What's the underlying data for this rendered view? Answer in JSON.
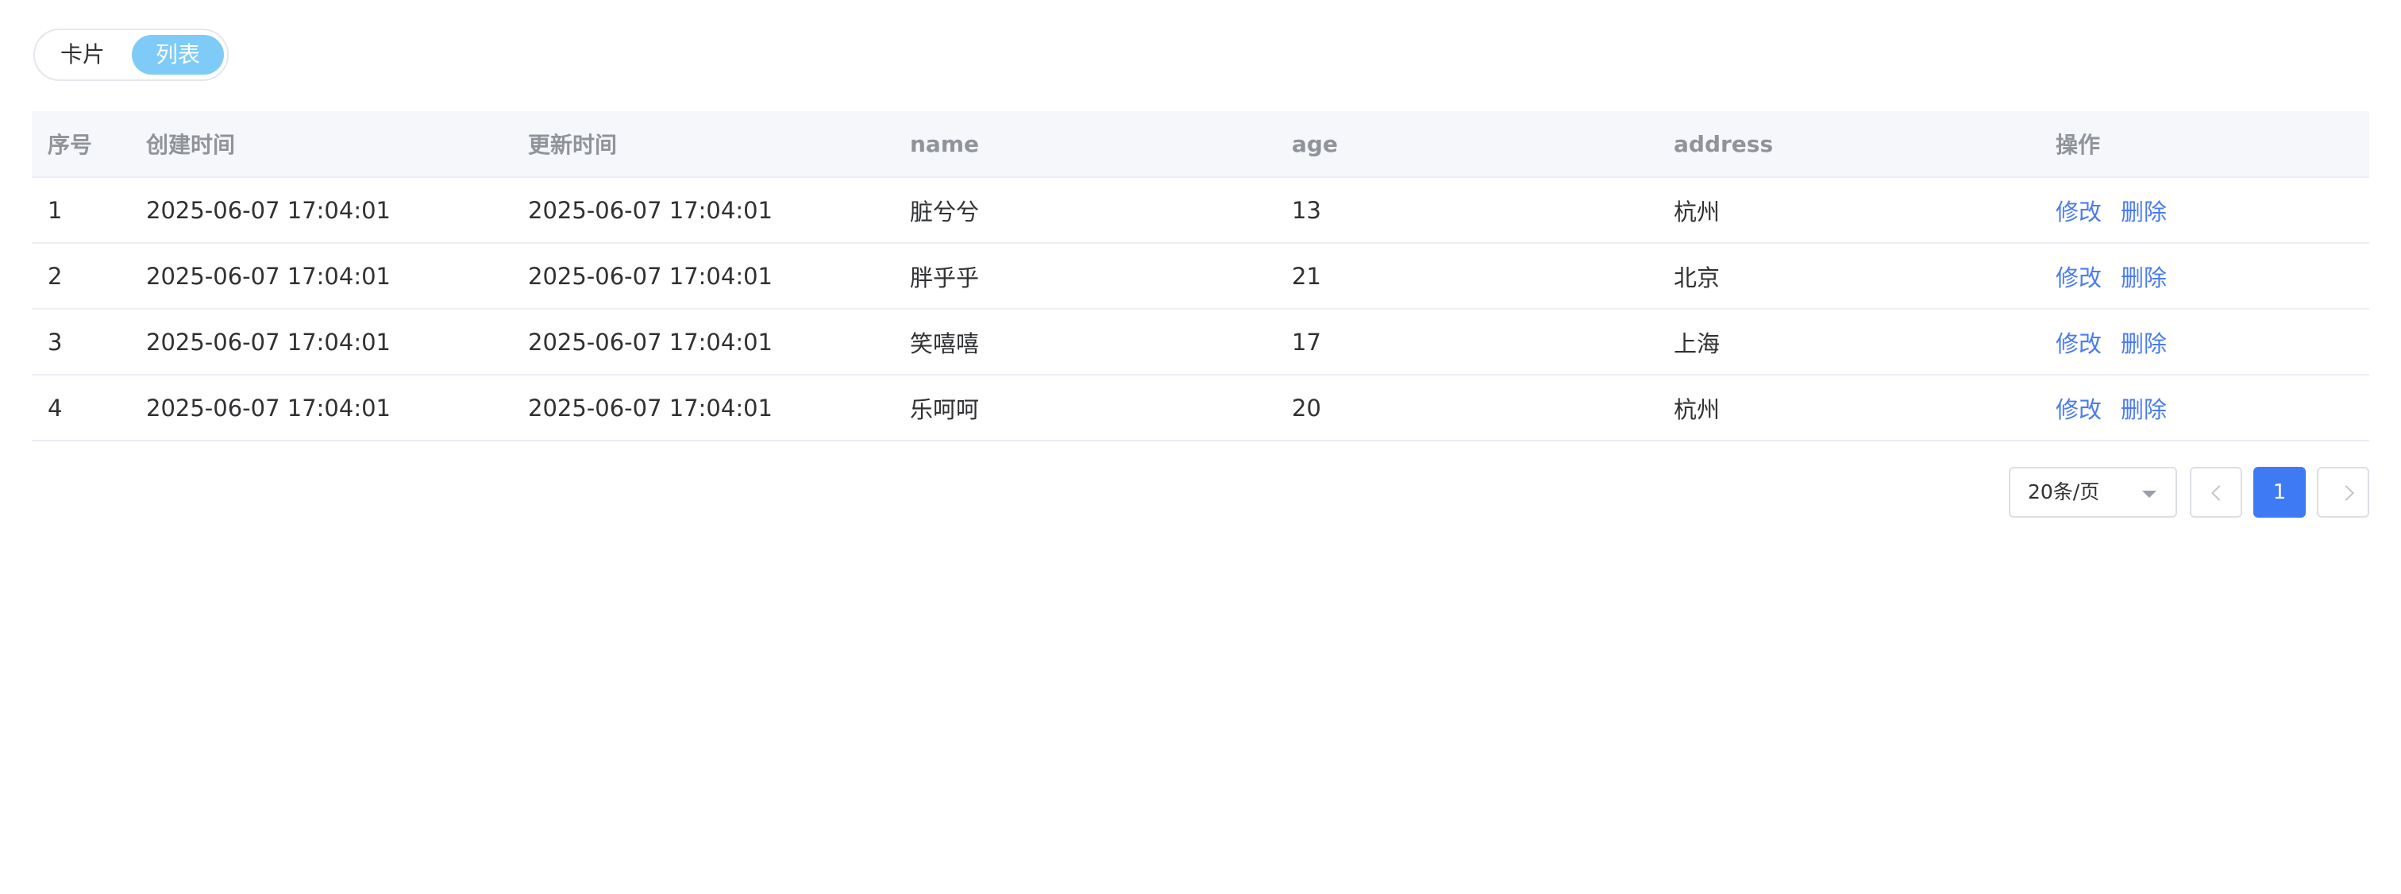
{
  "view_toggle": {
    "card_label": "卡片",
    "list_label": "列表"
  },
  "table": {
    "headers": [
      "序号",
      "创建时间",
      "更新时间",
      "name",
      "age",
      "address",
      "操作"
    ],
    "rows": [
      {
        "index": "1",
        "created": "2025-06-07 17:04:01",
        "updated": "2025-06-07 17:04:01",
        "name": "脏兮兮",
        "age": "13",
        "address": "杭州"
      },
      {
        "index": "2",
        "created": "2025-06-07 17:04:01",
        "updated": "2025-06-07 17:04:01",
        "name": "胖乎乎",
        "age": "21",
        "address": "北京"
      },
      {
        "index": "3",
        "created": "2025-06-07 17:04:01",
        "updated": "2025-06-07 17:04:01",
        "name": "笑嘻嘻",
        "age": "17",
        "address": "上海"
      },
      {
        "index": "4",
        "created": "2025-06-07 17:04:01",
        "updated": "2025-06-07 17:04:01",
        "name": "乐呵呵",
        "age": "20",
        "address": "杭州"
      }
    ],
    "actions": {
      "edit_label": "修改",
      "delete_label": "删除"
    }
  },
  "pagination": {
    "page_size_label": "20条/页",
    "current_page": "1",
    "prev_icon": "chevron-left-icon",
    "next_icon": "chevron-right-icon"
  },
  "colors": {
    "accent": "#3f7af5",
    "link": "#4a7cf0",
    "toggle_active": "#7ecbf8",
    "header_bg": "#f5f7fa"
  }
}
